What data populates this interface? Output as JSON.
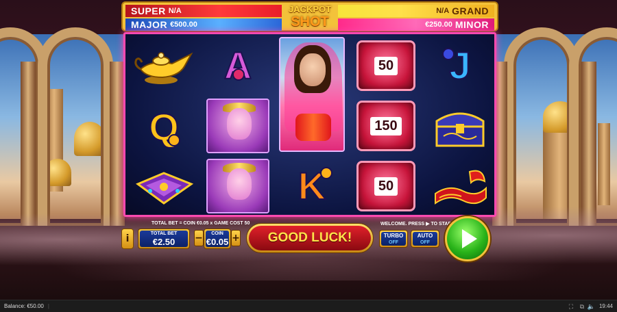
{
  "jackpots": {
    "super": {
      "label": "SUPER",
      "value": "N/A"
    },
    "major": {
      "label": "MAJOR",
      "value": "€500.00"
    },
    "grand": {
      "label": "GRAND",
      "value": "N/A"
    },
    "minor": {
      "label": "MINOR",
      "value": "€250.00"
    },
    "logo_line1": "JACKPOT",
    "logo_line2": "SHOT"
  },
  "reels": {
    "letters": {
      "a": "A",
      "j": "J",
      "q": "Q",
      "k": "K"
    },
    "gem_values": [
      "50",
      "150",
      "50"
    ]
  },
  "controls": {
    "info_label": "i",
    "total_bet_note": "TOTAL BET = COIN €0.05 x GAME COST 50",
    "total_bet_label": "TOTAL BET",
    "total_bet_value": "€2.50",
    "coin_label": "COIN",
    "coin_value": "€0.05",
    "coin_minus": "−",
    "coin_plus": "+",
    "status_message": "GOOD LUCK!",
    "welcome_note": "WELCOME. PRESS ▶ TO START",
    "turbo_label": "TURBO",
    "turbo_state": "OFF",
    "auto_label": "AUTO",
    "auto_state": "OFF"
  },
  "statusbar": {
    "balance": "Balance: €50.00",
    "time": "19:44"
  },
  "colors": {
    "reel_border": "#ff4ab0",
    "jackpot_frame": "#f3c23a",
    "spin_button": "#2ab41a",
    "message_bg": "#e0202a"
  }
}
